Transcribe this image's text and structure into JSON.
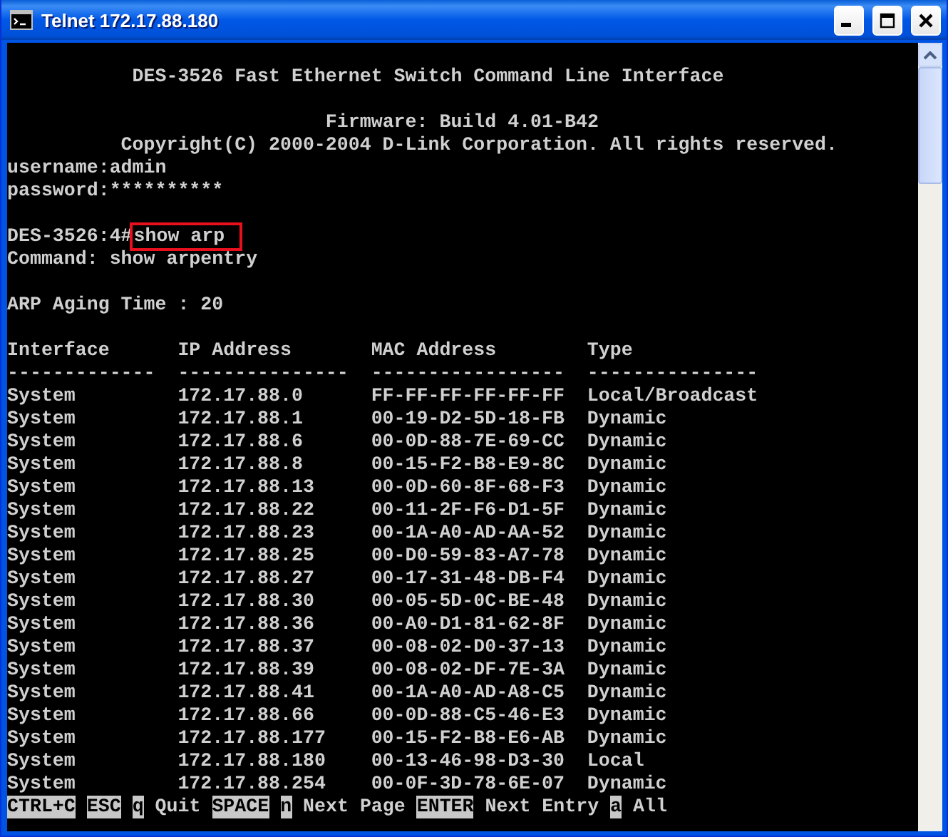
{
  "window": {
    "title": "Telnet 172.17.88.180"
  },
  "console": {
    "header": [
      {
        "kind": "banner",
        "text": "DES-3526 Fast Ethernet Switch Command Line Interface"
      },
      {
        "kind": "firmware",
        "text": "Firmware: Build 4.01-B42"
      },
      {
        "kind": "copyright",
        "text": "Copyright(C) 2000-2004 D-Link Corporation. All rights reserved."
      },
      {
        "kind": "plain",
        "text": "username:admin"
      },
      {
        "kind": "plain",
        "text": "password:**********"
      }
    ],
    "prompt": {
      "text": "DES-3526:4#",
      "command": "show arp",
      "highlighted": true
    },
    "echo": "Command: show arpentry",
    "aging": "ARP Aging Time : 20",
    "table": {
      "columns": [
        {
          "label": "Interface",
          "underline": "-------------"
        },
        {
          "label": "IP Address",
          "underline": "---------------"
        },
        {
          "label": "MAC Address",
          "underline": "-----------------"
        },
        {
          "label": "Type",
          "underline": "---------------"
        }
      ],
      "rows": [
        [
          "System",
          "172.17.88.0",
          "FF-FF-FF-FF-FF-FF",
          "Local/Broadcast"
        ],
        [
          "System",
          "172.17.88.1",
          "00-19-D2-5D-18-FB",
          "Dynamic"
        ],
        [
          "System",
          "172.17.88.6",
          "00-0D-88-7E-69-CC",
          "Dynamic"
        ],
        [
          "System",
          "172.17.88.8",
          "00-15-F2-B8-E9-8C",
          "Dynamic"
        ],
        [
          "System",
          "172.17.88.13",
          "00-0D-60-8F-68-F3",
          "Dynamic"
        ],
        [
          "System",
          "172.17.88.22",
          "00-11-2F-F6-D1-5F",
          "Dynamic"
        ],
        [
          "System",
          "172.17.88.23",
          "00-1A-A0-AD-AA-52",
          "Dynamic"
        ],
        [
          "System",
          "172.17.88.25",
          "00-D0-59-83-A7-78",
          "Dynamic"
        ],
        [
          "System",
          "172.17.88.27",
          "00-17-31-48-DB-F4",
          "Dynamic"
        ],
        [
          "System",
          "172.17.88.30",
          "00-05-5D-0C-BE-48",
          "Dynamic"
        ],
        [
          "System",
          "172.17.88.36",
          "00-A0-D1-81-62-8F",
          "Dynamic"
        ],
        [
          "System",
          "172.17.88.37",
          "00-08-02-D0-37-13",
          "Dynamic"
        ],
        [
          "System",
          "172.17.88.39",
          "00-08-02-DF-7E-3A",
          "Dynamic"
        ],
        [
          "System",
          "172.17.88.41",
          "00-1A-A0-AD-A8-C5",
          "Dynamic"
        ],
        [
          "System",
          "172.17.88.66",
          "00-0D-88-C5-46-E3",
          "Dynamic"
        ],
        [
          "System",
          "172.17.88.177",
          "00-15-F2-B8-E6-AB",
          "Dynamic"
        ],
        [
          "System",
          "172.17.88.180",
          "00-13-46-98-D3-30",
          "Local"
        ],
        [
          "System",
          "172.17.88.254",
          "00-0F-3D-78-6E-07",
          "Dynamic"
        ]
      ]
    },
    "footer": [
      {
        "kind": "key",
        "text": "CTRL+C"
      },
      {
        "kind": "key",
        "text": "ESC"
      },
      {
        "kind": "key",
        "text": "q"
      },
      {
        "kind": "label",
        "text": "Quit"
      },
      {
        "kind": "key",
        "text": "SPACE"
      },
      {
        "kind": "key",
        "text": "n"
      },
      {
        "kind": "label",
        "text": "Next Page"
      },
      {
        "kind": "key",
        "text": "ENTER"
      },
      {
        "kind": "label",
        "text": "Next Entry"
      },
      {
        "kind": "key",
        "text": "a"
      },
      {
        "kind": "label",
        "text": "All"
      }
    ]
  }
}
